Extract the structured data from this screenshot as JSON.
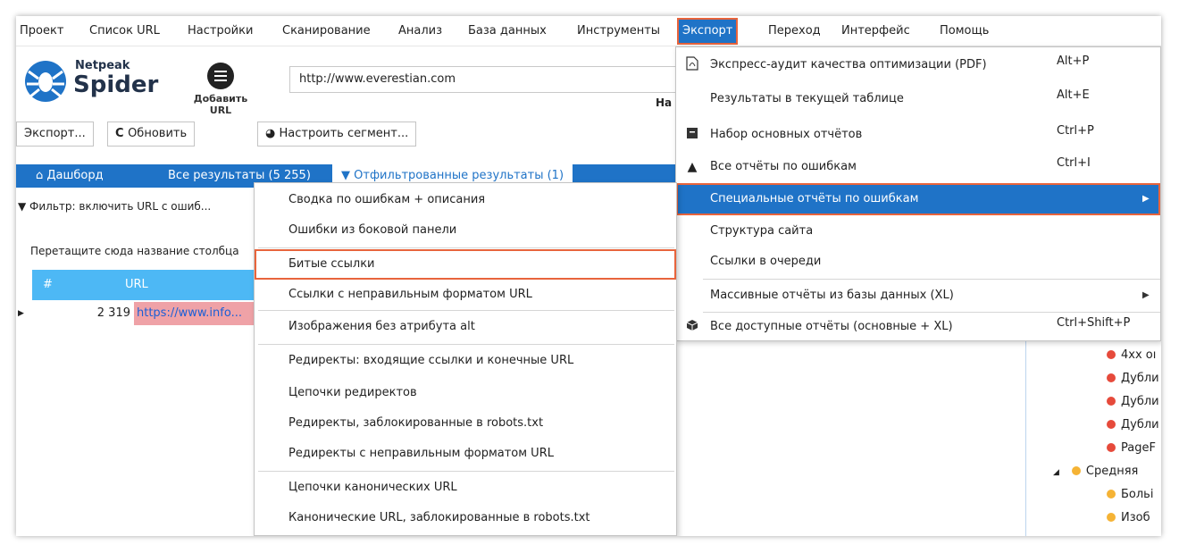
{
  "menu": [
    "Проект",
    "Список URL",
    "Настройки",
    "Сканирование",
    "Анализ",
    "База данных",
    "Инструменты",
    "Экспорт",
    "Переход",
    "Интерфейс",
    "Помощь"
  ],
  "logo": {
    "top": "Netpeak",
    "bottom": "Spider"
  },
  "add_url_label": "Добавить URL",
  "url_value": "http://www.everestian.com",
  "na_text": "На",
  "toolbar": {
    "export": "Экспорт...",
    "refresh": "Обновить",
    "segment": "Настроить сегмент..."
  },
  "tabs": {
    "dashboard": "Дашборд",
    "all_results": "Все результаты (5 255)",
    "filtered": "Отфильтрованные результаты (1)"
  },
  "filter_text": "Фильтр: включить URL с ошиб...",
  "drag_text": "Перетащите сюда название столбца",
  "grid": {
    "col_num": "#",
    "col_url": "URL",
    "row_num": "2 319",
    "row_url": "https://www.info..."
  },
  "export_menu": [
    {
      "icon": "pdf-icon",
      "label": "Экспресс-аудит качества оптимизации (PDF)",
      "shortcut": "Alt+P"
    },
    {
      "icon": "",
      "label": "Результаты в текущей таблице",
      "shortcut": "Alt+E"
    },
    {
      "icon": "report-set-icon",
      "label": "Набор основных отчётов",
      "shortcut": "Ctrl+P"
    },
    {
      "icon": "warning-icon",
      "label": "Все отчёты по ошибкам",
      "shortcut": "Ctrl+I"
    },
    {
      "icon": "",
      "label": "Специальные отчёты по ошибкам",
      "shortcut": ""
    },
    {
      "icon": "",
      "label": "Структура сайта",
      "shortcut": ""
    },
    {
      "icon": "",
      "label": "Ссылки в очереди",
      "shortcut": ""
    },
    {
      "icon": "",
      "label": "Массивные отчёты из базы данных (XL)",
      "shortcut": ""
    },
    {
      "icon": "box-icon",
      "label": "Все доступные отчёты (основные + XL)",
      "shortcut": "Ctrl+Shift+P"
    }
  ],
  "submenu": [
    "Сводка по ошибкам + описания",
    "Ошибки из боковой панели",
    "Битые ссылки",
    "Ссылки с неправильным форматом URL",
    "Изображения без атрибута alt",
    "Редиректы: входящие ссылки и конечные URL",
    "Цепочки редиректов",
    "Редиректы, заблокированные в robots.txt",
    "Редиректы с неправильным форматом URL",
    "Цепочки канонических URL",
    "Канонические URL, заблокированные в robots.txt"
  ],
  "tree": [
    {
      "label": "4xx oı",
      "color": "#e64a3b"
    },
    {
      "label": "Дубли",
      "color": "#e64a3b"
    },
    {
      "label": "Дубли",
      "color": "#e64a3b"
    },
    {
      "label": "Дубли",
      "color": "#e64a3b"
    },
    {
      "label": "PageF",
      "color": "#e64a3b"
    },
    {
      "label": "Средняя",
      "color": "#f5b335"
    },
    {
      "label": "Больі",
      "color": "#f5b335"
    },
    {
      "label": "Изоб",
      "color": "#f5b335"
    }
  ],
  "colors": {
    "accent": "#1f73c7",
    "highlight_border": "#e8643c",
    "grid_header": "#4db8f5",
    "error_row": "#efa2a7"
  }
}
